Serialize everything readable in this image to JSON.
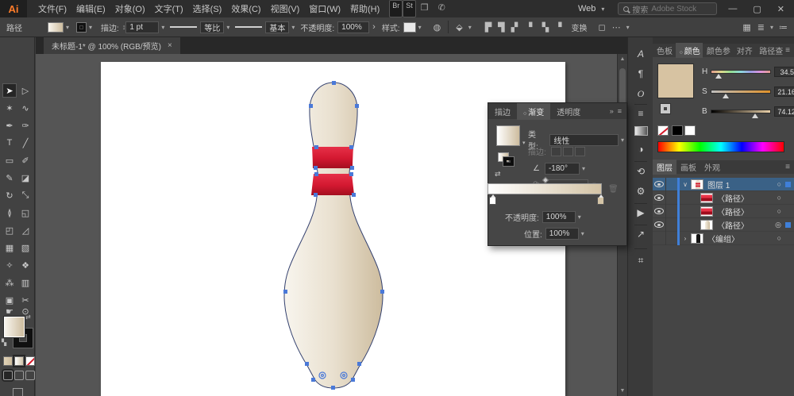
{
  "menu_bar": {
    "logo": "Ai",
    "items": [
      "文件(F)",
      "编辑(E)",
      "对象(O)",
      "文字(T)",
      "选择(S)",
      "效果(C)",
      "视图(V)",
      "窗口(W)",
      "帮助(H)"
    ],
    "badge_br": "Br",
    "badge_st": "St",
    "workspace_glyph": "❒",
    "share_glyph": "✆",
    "profile_label": "Web",
    "search_prefix": "搜索",
    "search_brand": "Adobe Stock",
    "minimize": "—",
    "restore": "▢",
    "close": "✕"
  },
  "options_bar": {
    "context_label": "路径",
    "stroke_label": "描边:",
    "stroke_weight": "1 pt",
    "stepper_glyph": "↕",
    "profile_label": "等比",
    "brush_label": "基本",
    "opacity_label": "不透明度:",
    "opacity_value": "100%",
    "more_glyph": "›",
    "style_label": "样式:",
    "recolor_glyph": "◍",
    "shape_glyph": "⬙",
    "align_glyphs": [
      "▛",
      "▜",
      "▞",
      "▘",
      "▚",
      "▝"
    ],
    "transform_label": "变换",
    "bounds_glyph": "◻",
    "extra_glyph": "⋯",
    "arrange_glyph": "▦",
    "workspace_glyph": "≣",
    "menu_glyph": "≔"
  },
  "document_tab": {
    "title": "未标题-1* @ 100% (RGB/预览)",
    "close_glyph": "×"
  },
  "toolbar": {
    "tools": [
      {
        "name": "selection",
        "glyph": "➤"
      },
      {
        "name": "direct-selection",
        "glyph": "▷"
      },
      {
        "name": "magic-wand",
        "glyph": "✶"
      },
      {
        "name": "lasso",
        "glyph": "∿"
      },
      {
        "name": "pen",
        "glyph": "✒"
      },
      {
        "name": "curvature",
        "glyph": "✑"
      },
      {
        "name": "type",
        "glyph": "T"
      },
      {
        "name": "line-segment",
        "glyph": "╱"
      },
      {
        "name": "rectangle",
        "glyph": "▭"
      },
      {
        "name": "paintbrush",
        "glyph": "✐"
      },
      {
        "name": "pencil",
        "glyph": "✎"
      },
      {
        "name": "eraser",
        "glyph": "◪"
      },
      {
        "name": "rotate",
        "glyph": "↻"
      },
      {
        "name": "scale",
        "glyph": "⤡"
      },
      {
        "name": "width",
        "glyph": "≬"
      },
      {
        "name": "free-transform",
        "glyph": "◱"
      },
      {
        "name": "shape-builder",
        "glyph": "◰"
      },
      {
        "name": "perspective-grid",
        "glyph": "◿"
      },
      {
        "name": "mesh",
        "glyph": "▦"
      },
      {
        "name": "gradient",
        "glyph": "▧"
      },
      {
        "name": "eyedropper",
        "glyph": "✧"
      },
      {
        "name": "blend",
        "glyph": "❖"
      },
      {
        "name": "symbol-sprayer",
        "glyph": "⁂"
      },
      {
        "name": "column-graph",
        "glyph": "▥"
      },
      {
        "name": "artboard",
        "glyph": "▣"
      },
      {
        "name": "slice",
        "glyph": "✂"
      },
      {
        "name": "hand",
        "glyph": "☛"
      },
      {
        "name": "zoom",
        "glyph": "⊙"
      }
    ],
    "swap_glyph": "⇄",
    "default_glyph": "▚"
  },
  "canvas": {
    "pin": {
      "light": "#f8f5ee",
      "mid": "#e9e0cf",
      "dark": "#cdbc9e",
      "stripe_top": "#e63048",
      "stripe_mid": "#d31830",
      "stripe_dark": "#a30f20",
      "outline": "#33406e",
      "anchor": "#4a79d8"
    }
  },
  "gradient_panel": {
    "tab_stroke": "描边",
    "tab_gradient": "渐变",
    "tab_transparency": "透明度",
    "tab_dot": "○",
    "collapse_glyph": "»",
    "menu_glyph": "≡",
    "type_label": "类型:",
    "type_value": "线性",
    "stroke_label": "描边:",
    "angle_glyph": "∠",
    "angle_value": "-180°",
    "reverse_glyph": "⇄",
    "annotator_glyph": "⟳",
    "opacity_label": "不透明度:",
    "opacity_value": "100%",
    "position_label": "位置:",
    "position_value": "100%",
    "trash_glyph": "🗑"
  },
  "dock_strip": {
    "icons": [
      {
        "name": "character",
        "glyph": "A"
      },
      {
        "name": "paragraph",
        "glyph": "¶"
      },
      {
        "name": "opentype",
        "glyph": "O"
      },
      {
        "name": "stroke",
        "glyph": "≡"
      },
      {
        "name": "transparency",
        "glyph": "◑"
      },
      {
        "name": "symbols",
        "glyph": "⟲"
      },
      {
        "name": "graphic-styles",
        "glyph": "⚙"
      },
      {
        "name": "actions",
        "glyph": "▶"
      },
      {
        "name": "export",
        "glyph": "↗"
      },
      {
        "name": "artboards",
        "glyph": "⌗"
      }
    ]
  },
  "color_panel": {
    "tab_swatches": "色板",
    "tab_color": "颜色",
    "tab_guide": "颜色参",
    "tab_align": "对齐",
    "tab_pathfinder": "路径查",
    "tab_dot": "○",
    "menu_glyph": "≡",
    "swatch": "#d7c3a2",
    "h_label": "H",
    "h_value": "34.5",
    "h_unit": "°",
    "s_label": "S",
    "s_value": "21.16",
    "s_unit": "%",
    "b_label": "B",
    "b_value": "74.12",
    "b_unit": "%"
  },
  "layers_panel": {
    "tab_layers": "图层",
    "tab_artboards": "画板",
    "tab_appearance": "外观",
    "menu_glyph": "≡",
    "rows": [
      {
        "label": "图层 1",
        "chevron": "∨",
        "target": "○"
      },
      {
        "label": "〈路径〉",
        "target": "○"
      },
      {
        "label": "〈路径〉",
        "target": "○"
      },
      {
        "label": "〈路径〉",
        "target": "◎"
      },
      {
        "label": "〈编组〉",
        "chevron": "›",
        "target": "○"
      }
    ]
  },
  "scrollbar": {
    "up": "▲",
    "down": "▼"
  }
}
